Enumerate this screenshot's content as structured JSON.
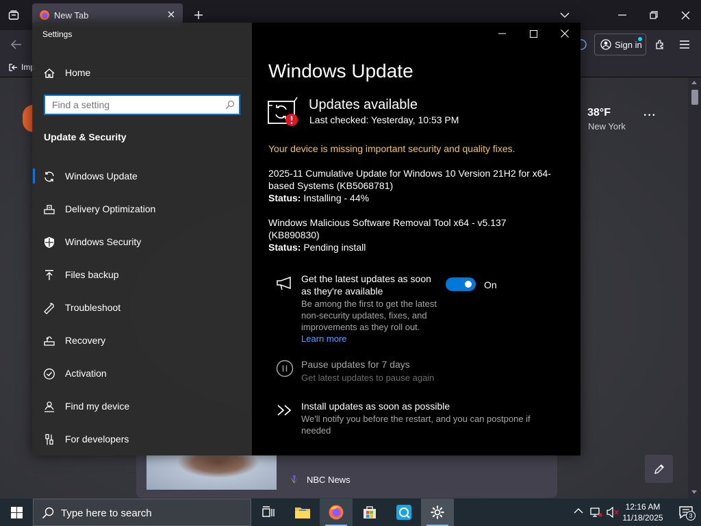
{
  "browser": {
    "tab_title": "New Tab",
    "bookmark_import": "Imp",
    "sign_in": "Sign in"
  },
  "settings": {
    "app_title": "Settings",
    "home": "Home",
    "search_placeholder": "Find a setting",
    "section_title": "Update & Security",
    "nav": [
      {
        "label": "Windows Update",
        "icon": "refresh-icon"
      },
      {
        "label": "Delivery Optimization",
        "icon": "delivery-icon"
      },
      {
        "label": "Windows Security",
        "icon": "shield-icon"
      },
      {
        "label": "Files backup",
        "icon": "upload-icon"
      },
      {
        "label": "Troubleshoot",
        "icon": "wrench-icon"
      },
      {
        "label": "Recovery",
        "icon": "recovery-icon"
      },
      {
        "label": "Activation",
        "icon": "check-circle-icon"
      },
      {
        "label": "Find my device",
        "icon": "person-location-icon"
      },
      {
        "label": "For developers",
        "icon": "developer-icon"
      }
    ],
    "page_title": "Windows Update",
    "status_heading": "Updates available",
    "last_checked": "Last checked: Yesterday, 10:53 PM",
    "warning": "Your device is missing important security and quality fixes.",
    "updates": [
      {
        "name": "2025-11 Cumulative Update for Windows 10 Version 21H2 for x64-based Systems (KB5068781)",
        "status_label": "Status:",
        "status": "Installing - 44%",
        "progress_percent": 44
      },
      {
        "name": "Windows Malicious Software Removal Tool x64 - v5.137 (KB890830)",
        "status_label": "Status:",
        "status": "Pending install"
      }
    ],
    "options": {
      "latest_title": "Get the latest updates as soon as they're available",
      "latest_desc": "Be among the first to get the latest non-security updates, fixes, and improvements as they roll out.",
      "learn_more": "Learn more",
      "toggle_state": "On",
      "pause_title": "Pause updates for 7 days",
      "pause_desc": "Get latest updates to pause again",
      "install_title": "Install updates as soon as possible",
      "install_desc": "We'll notify you before the restart, and you can postpone if needed"
    }
  },
  "weather": {
    "temp": "38°F",
    "city": "New York",
    "more": "···"
  },
  "news": {
    "source": "NBC News"
  },
  "taskbar": {
    "search_text": "Type here to search",
    "time": "12:16 AM",
    "date": "11/18/2025",
    "notification_count": "3"
  },
  "colors": {
    "accent": "#0078d7",
    "warning": "#f7c544",
    "error": "#e81123",
    "link": "#4aa3ff"
  }
}
